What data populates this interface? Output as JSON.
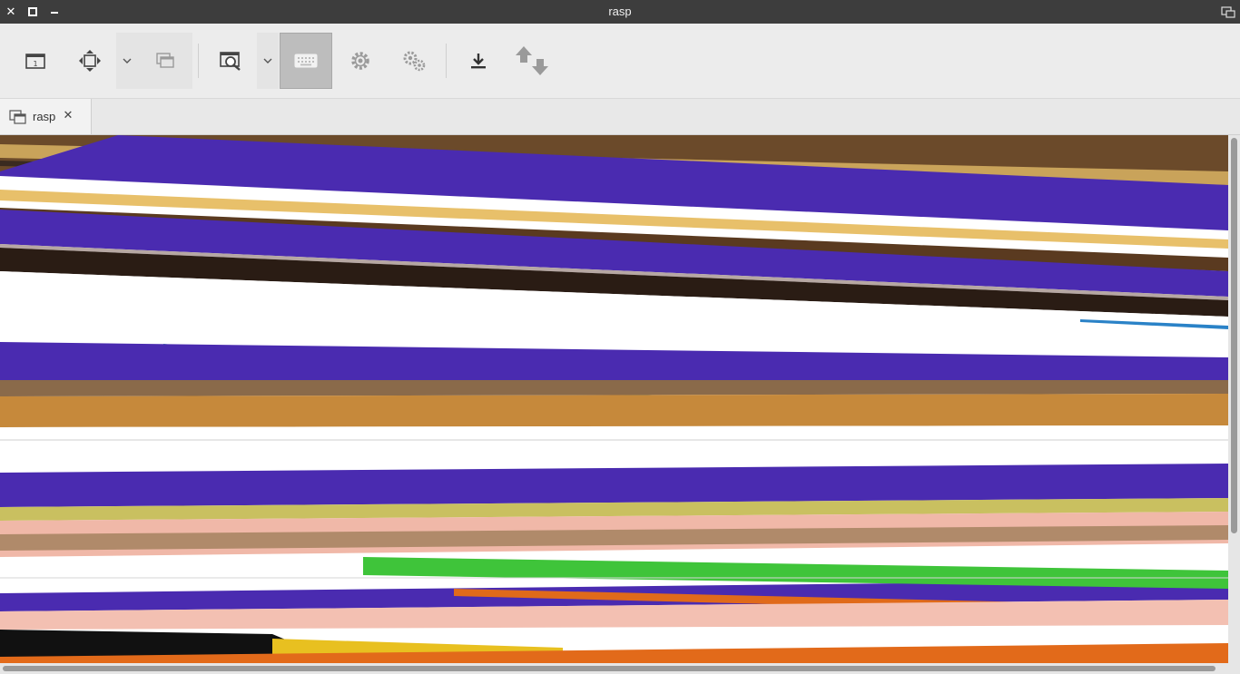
{
  "window": {
    "title": "rasp"
  },
  "toolbar": {
    "buttons": [
      {
        "name": "fullscreen",
        "icon": "fullscreen-icon"
      },
      {
        "name": "fit-window",
        "icon": "move-arrows-icon"
      },
      {
        "name": "scaling-dropdown",
        "icon": "chevron-down-icon"
      },
      {
        "name": "multi-monitor",
        "icon": "windows-icon"
      },
      {
        "name": "zoom",
        "icon": "zoom-icon"
      },
      {
        "name": "zoom-dropdown",
        "icon": "chevron-down-icon"
      },
      {
        "name": "keyboard-grab",
        "icon": "keyboard-icon",
        "active": true
      },
      {
        "name": "preferences",
        "icon": "gear-icon"
      },
      {
        "name": "tools",
        "icon": "gears-icon"
      },
      {
        "name": "minimize-toolbar",
        "icon": "download-icon"
      },
      {
        "name": "transfer",
        "icon": "up-down-arrows-icon"
      }
    ]
  },
  "tabs": [
    {
      "label": "rasp",
      "close": "✕"
    }
  ],
  "colors": {
    "titlebar": "#3d3d3d",
    "toolbar": "#ececec",
    "active_button": "#bdbdbd",
    "stripe_purple": "#4a2bb0"
  }
}
